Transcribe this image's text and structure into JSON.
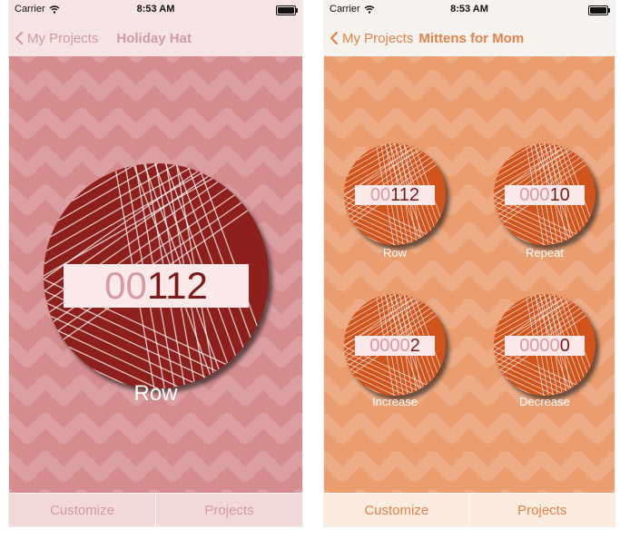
{
  "status": {
    "carrier": "Carrier",
    "time": "8:53 AM"
  },
  "left": {
    "back_label": "My Projects",
    "title": "Holiday Hat",
    "counter": {
      "lead": "00",
      "value": "112",
      "label": "Row"
    },
    "tabs": [
      "Customize",
      "Projects"
    ],
    "colors": {
      "background": "#d58c8f",
      "nav": "#f6e3e4",
      "accent": "#d29b9e",
      "yarn": "#8d1f1c",
      "tab": "#f3d8d9"
    }
  },
  "right": {
    "back_label": "My Projects",
    "title": "Mittens for Mom",
    "counters": [
      {
        "lead": "00",
        "value": "112",
        "label": "Row"
      },
      {
        "lead": "000",
        "value": "10",
        "label": "Repeat"
      },
      {
        "lead": "0000",
        "value": "2",
        "label": "Increase"
      },
      {
        "lead": "0000",
        "value": "0",
        "label": "Decrease"
      }
    ],
    "tabs": [
      "Customize",
      "Projects"
    ],
    "colors": {
      "background": "#eb9d6f",
      "nav": "#f6f3ef",
      "accent": "#e0824a",
      "yarn": "#d2541d",
      "tab": "#fbecdf"
    }
  }
}
